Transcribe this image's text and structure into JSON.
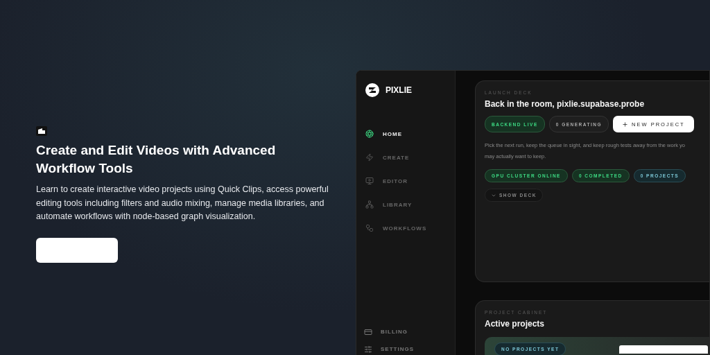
{
  "hero": {
    "title": "Create and Edit Videos with Advanced Workflow Tools",
    "description": "Learn to create interactive video projects using Quick Clips, access powerful editing tools including filters and audio mixing, manage media libraries, and automate workflows with node-based graph visualization."
  },
  "app": {
    "brand": "PIXLIE",
    "nav": [
      {
        "label": "HOME",
        "selected": true
      },
      {
        "label": "CREATE",
        "selected": false
      },
      {
        "label": "EDITOR",
        "selected": false
      },
      {
        "label": "LIBRARY",
        "selected": false
      },
      {
        "label": "WORKFLOWS",
        "selected": false
      }
    ],
    "footer_nav": [
      {
        "label": "BILLING"
      },
      {
        "label": "SETTINGS"
      }
    ],
    "launch_deck": {
      "eyebrow": "LAUNCH DECK",
      "title": "Back in the room, pixlie.supabase.probe",
      "badges": [
        {
          "label": "BACKEND LIVE",
          "kind": "green"
        },
        {
          "label": "0 GENERATING",
          "kind": "neutral"
        }
      ],
      "new_project": "NEW PROJECT",
      "description": [
        "Pick the next run, keep the queue in sight, and keep rough tests away from the work yo",
        "may actually want to keep."
      ],
      "stats": [
        {
          "label": "GPU CLUSTER ONLINE",
          "kind": "green"
        },
        {
          "label": "0 COMPLETED",
          "kind": "green"
        },
        {
          "label": "0 PROJECTS",
          "kind": "teal"
        }
      ],
      "show_deck": "SHOW DECK"
    },
    "cabinet": {
      "eyebrow": "PROJECT CABINET",
      "title": "Active projects",
      "badge": "NO PROJECTS YET"
    }
  }
}
